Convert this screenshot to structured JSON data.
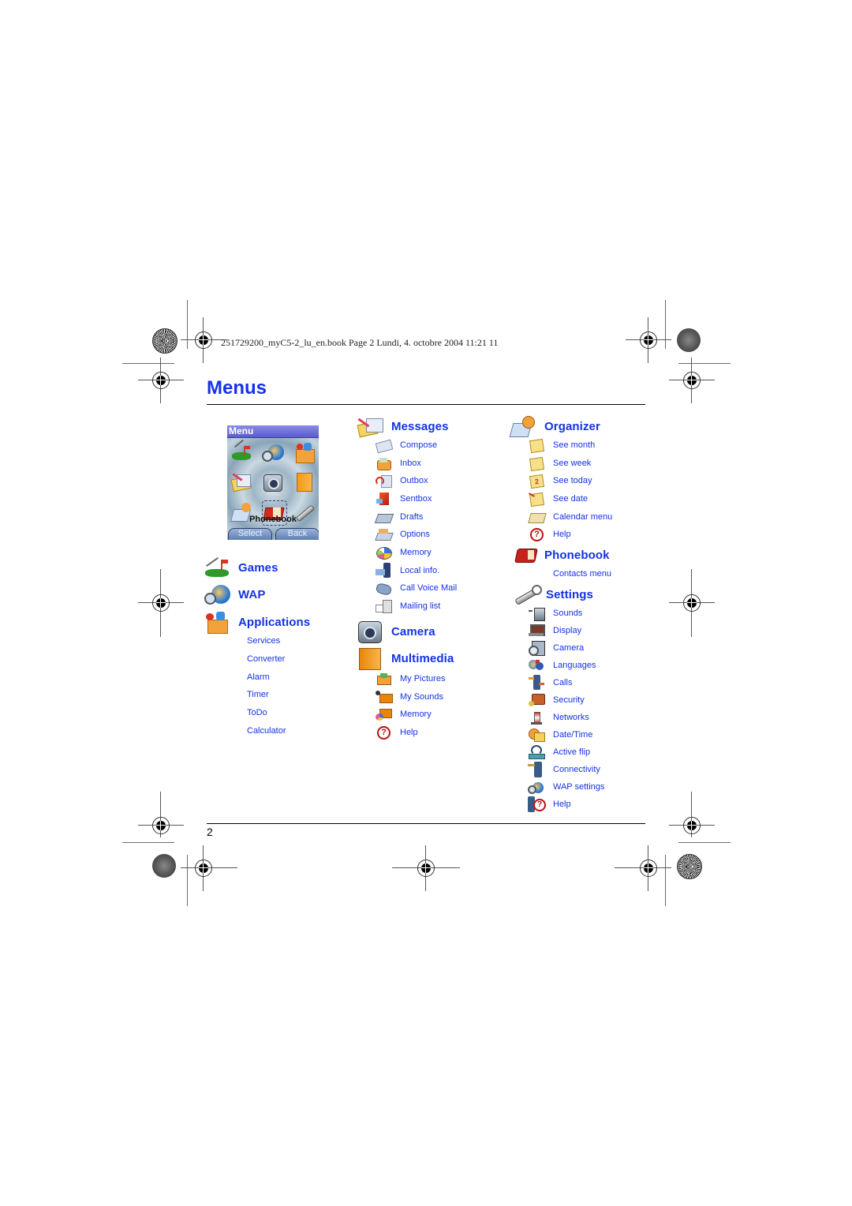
{
  "header": {
    "book_info": "251729200_myC5-2_lu_en.book  Page 2  Lundi, 4. octobre 2004  11:21 11"
  },
  "page": {
    "title": "Menus",
    "page_number": "2"
  },
  "phone_screen": {
    "title": "Menu",
    "selected_label": "Phonebook",
    "softkeys": {
      "left": "Select",
      "right": "Back"
    },
    "grid_icons": [
      "games-icon",
      "wap-icon",
      "applications-icon",
      "messages-icon",
      "camera-icon",
      "multimedia-icon",
      "organizer-icon",
      "phonebook-icon",
      "settings-icon"
    ]
  },
  "columns": {
    "left": {
      "sections": [
        {
          "title": "Games",
          "icon": "games-icon",
          "items": []
        },
        {
          "title": "WAP",
          "icon": "wap-icon",
          "items": []
        },
        {
          "title": "Applications",
          "icon": "applications-icon",
          "items": [
            "Services",
            "Converter",
            "Alarm",
            "Timer",
            "ToDo",
            "Calculator"
          ]
        }
      ]
    },
    "middle": {
      "sections": [
        {
          "title": "Messages",
          "icon": "messages-icon",
          "items": [
            {
              "label": "Compose",
              "icon": "compose-icon"
            },
            {
              "label": "Inbox",
              "icon": "inbox-icon"
            },
            {
              "label": "Outbox",
              "icon": "outbox-icon"
            },
            {
              "label": "Sentbox",
              "icon": "sentbox-icon"
            },
            {
              "label": "Drafts",
              "icon": "drafts-icon"
            },
            {
              "label": "Options",
              "icon": "options-icon"
            },
            {
              "label": "Memory",
              "icon": "memory-pie-icon"
            },
            {
              "label": "Local info.",
              "icon": "local-info-icon"
            },
            {
              "label": "Call Voice Mail",
              "icon": "voicemail-icon"
            },
            {
              "label": "Mailing list",
              "icon": "mailing-list-icon"
            }
          ]
        },
        {
          "title": "Camera",
          "icon": "camera-icon",
          "items": []
        },
        {
          "title": "Multimedia",
          "icon": "multimedia-icon",
          "items": [
            {
              "label": "My Pictures",
              "icon": "my-pictures-icon"
            },
            {
              "label": "My Sounds",
              "icon": "my-sounds-icon"
            },
            {
              "label": "Memory",
              "icon": "memory-icon"
            },
            {
              "label": "Help",
              "icon": "help-icon"
            }
          ]
        }
      ]
    },
    "right": {
      "sections": [
        {
          "title": "Organizer",
          "icon": "organizer-icon",
          "items": [
            {
              "label": "See month",
              "icon": "calendar-month-icon"
            },
            {
              "label": "See week",
              "icon": "calendar-week-icon"
            },
            {
              "label": "See today",
              "icon": "calendar-today-icon"
            },
            {
              "label": "See date",
              "icon": "calendar-date-icon"
            },
            {
              "label": "Calendar menu",
              "icon": "calendar-menu-icon"
            },
            {
              "label": "Help",
              "icon": "help-icon"
            }
          ]
        },
        {
          "title": "Phonebook",
          "icon": "phonebook-icon",
          "items": [
            {
              "label": "Contacts menu",
              "icon": ""
            }
          ]
        },
        {
          "title": "Settings",
          "icon": "settings-icon",
          "items": [
            {
              "label": "Sounds",
              "icon": "sounds-icon"
            },
            {
              "label": "Display",
              "icon": "display-icon"
            },
            {
              "label": "Camera",
              "icon": "camera-settings-icon"
            },
            {
              "label": "Languages",
              "icon": "languages-icon"
            },
            {
              "label": "Calls",
              "icon": "calls-icon"
            },
            {
              "label": "Security",
              "icon": "security-icon"
            },
            {
              "label": "Networks",
              "icon": "networks-icon"
            },
            {
              "label": "Date/Time",
              "icon": "date-time-icon"
            },
            {
              "label": "Active flip",
              "icon": "active-flip-icon"
            },
            {
              "label": "Connectivity",
              "icon": "connectivity-icon"
            },
            {
              "label": "WAP settings",
              "icon": "wap-settings-icon"
            },
            {
              "label": "Help",
              "icon": "phone-help-icon"
            }
          ]
        }
      ]
    }
  },
  "colors": {
    "heading_blue": "#1432e6",
    "phone_titlebar": "#6a6cd6"
  }
}
